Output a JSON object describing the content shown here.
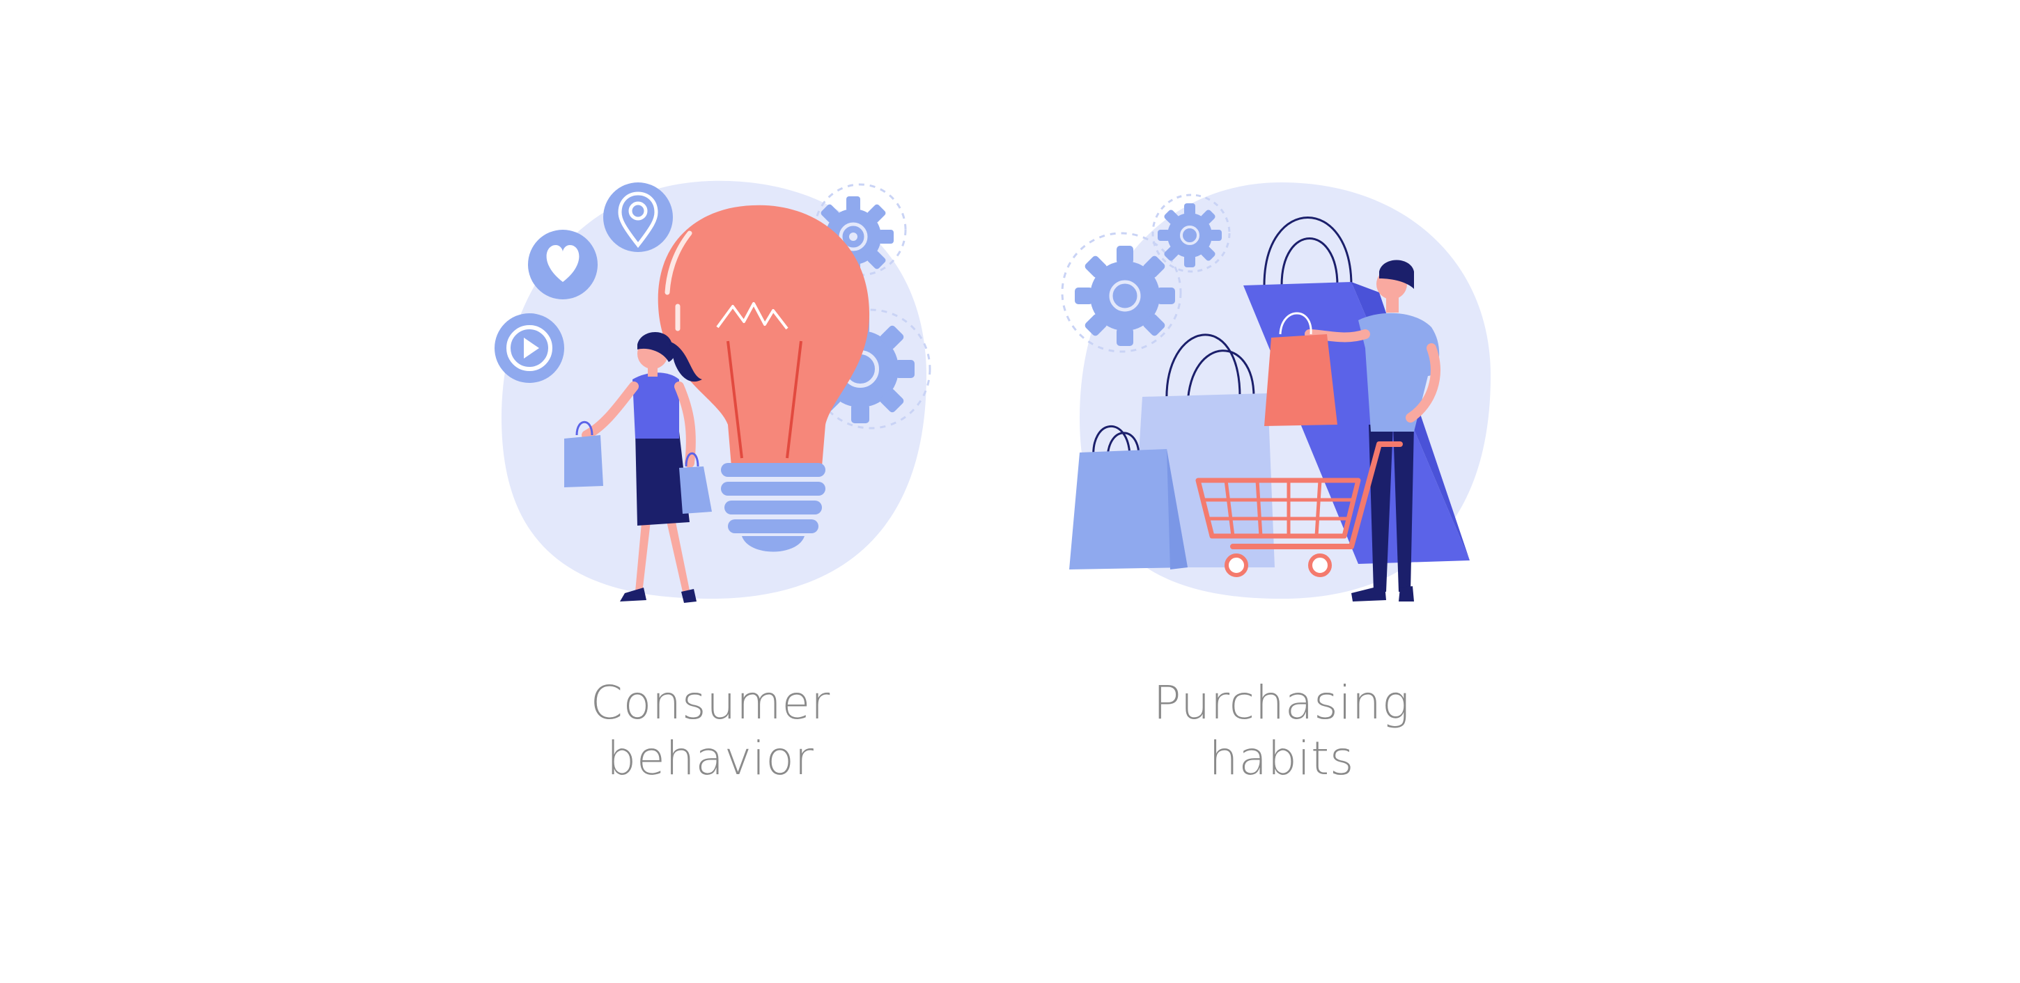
{
  "captions": {
    "consumer": {
      "line1": "Consumer",
      "line2": "behavior"
    },
    "purchase": {
      "line1": "Purchasing",
      "line2": "habits"
    }
  },
  "icons": {
    "consumer": [
      "play-icon",
      "heart-icon",
      "location-pin-icon",
      "gear-icon",
      "lightbulb-icon",
      "shopping-bag-icon"
    ],
    "purchase": [
      "gear-icon",
      "shopping-bag-icon",
      "shopping-cart-icon"
    ]
  },
  "colors": {
    "background": "#ffffff",
    "blob": "#e3e8fb",
    "accent_blue": "#8fa9ee",
    "deep_blue": "#5b63e8",
    "navy": "#1b1f6b",
    "coral": "#f47a6d",
    "caption_gray": "#8a8a8a"
  }
}
